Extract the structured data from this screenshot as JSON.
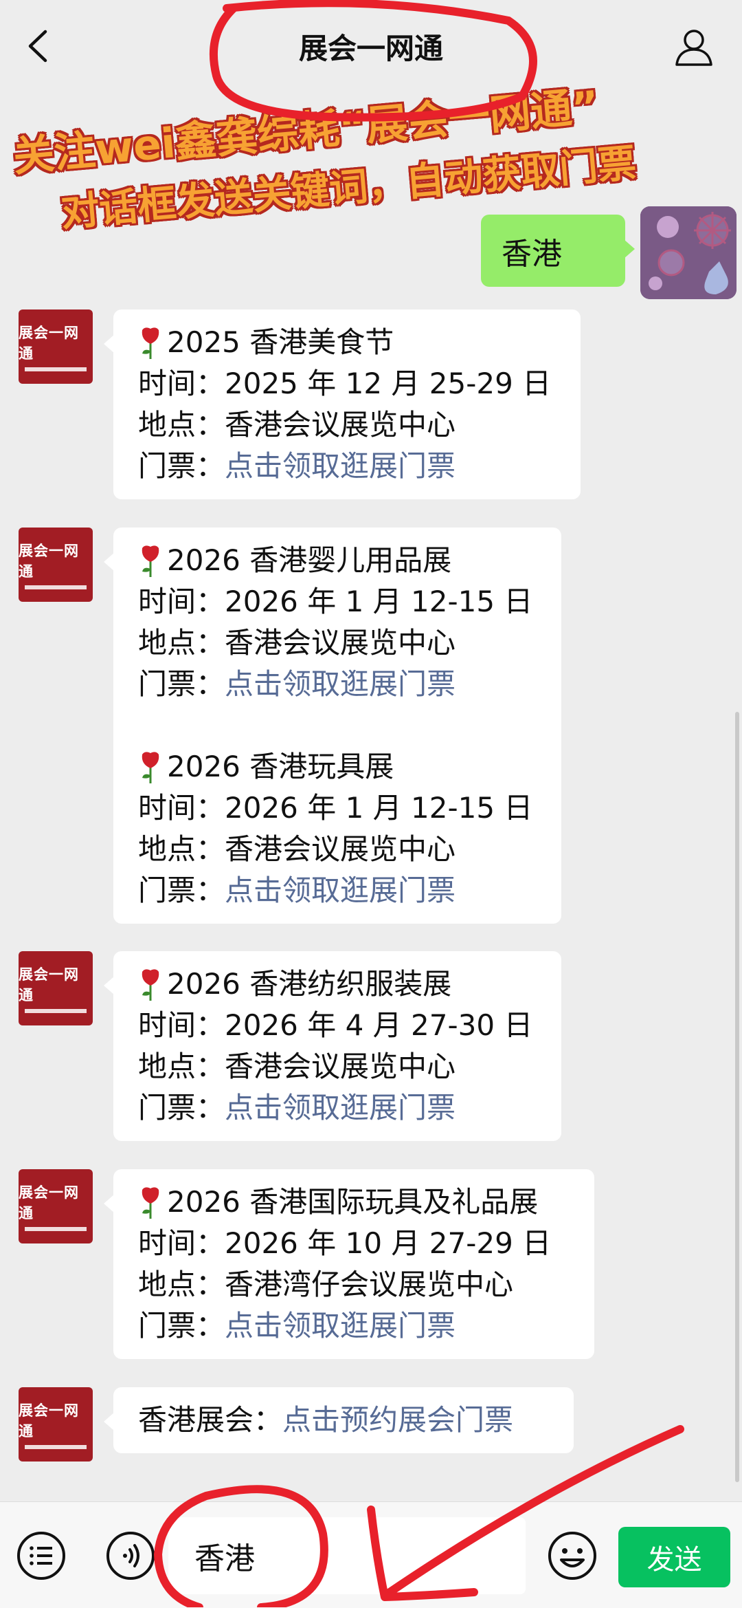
{
  "header": {
    "title": "展会一网通"
  },
  "promo": {
    "line1": "关注wei鑫龚综耗“展会一网通”",
    "line2": "对话框发送关键词，自动获取门票"
  },
  "user_message": {
    "text": "香港"
  },
  "bot": {
    "avatar_text": "展会一网通"
  },
  "messages": [
    {
      "events": [
        {
          "title": "2025 香港美食节",
          "time_label": "时间：",
          "time": "2025 年 12 月 25-29 日",
          "place_label": "地点：",
          "place": "香港会议展览中心",
          "ticket_label": "门票：",
          "ticket_link": "点击领取逛展门票"
        }
      ]
    },
    {
      "events": [
        {
          "title": "2026 香港婴儿用品展",
          "time_label": "时间：",
          "time": "2026 年 1 月 12-15 日",
          "place_label": "地点：",
          "place": "香港会议展览中心",
          "ticket_label": "门票：",
          "ticket_link": "点击领取逛展门票"
        },
        {
          "title": "2026 香港玩具展",
          "time_label": "时间：",
          "time": "2026 年 1 月 12-15 日",
          "place_label": "地点：",
          "place": "香港会议展览中心",
          "ticket_label": "门票：",
          "ticket_link": "点击领取逛展门票"
        }
      ]
    },
    {
      "events": [
        {
          "title": "2026 香港纺织服装展",
          "time_label": "时间：",
          "time": "2026 年 4 月 27-30 日",
          "place_label": "地点：",
          "place": "香港会议展览中心",
          "ticket_label": "门票：",
          "ticket_link": "点击领取逛展门票"
        }
      ]
    },
    {
      "events": [
        {
          "title": "2026 香港国际玩具及礼品展",
          "time_label": "时间：",
          "time": "2026 年 10 月 27-29 日",
          "place_label": "地点：",
          "place": "香港湾仔会议展览中心",
          "ticket_label": "门票：",
          "ticket_link": "点击领取逛展门票"
        }
      ]
    }
  ],
  "last_message": {
    "label": "香港展会：",
    "link": "点击预约展会门票"
  },
  "input": {
    "value": "香港",
    "send_label": "发送"
  },
  "colors": {
    "accent_green": "#07c160",
    "bubble_green": "#95ec69",
    "link": "#576b95",
    "avatar_red": "#a21d24",
    "annotation_red": "#e8212b"
  }
}
